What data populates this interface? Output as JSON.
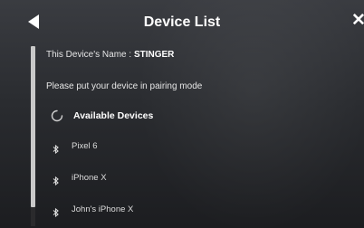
{
  "header": {
    "title": "Device List"
  },
  "device_info": {
    "name_prefix": "This Device's Name : ",
    "name_value": "STINGER"
  },
  "instructions": "Please put your device in pairing mode",
  "available": {
    "label": "Available Devices"
  },
  "devices": [
    {
      "label": "Pixel 6"
    },
    {
      "label": "iPhone X"
    },
    {
      "label": "John's iPhone X"
    }
  ],
  "colors": {
    "background_top": "#3a3c41",
    "background_bottom": "#1c1d20",
    "text": "#ffffff",
    "scrollbar": "#c9c9c9"
  },
  "icons": {
    "back": "back-arrow-icon",
    "close": "close-icon",
    "spinner": "loading-spinner-icon",
    "device": "bluetooth-icon"
  }
}
